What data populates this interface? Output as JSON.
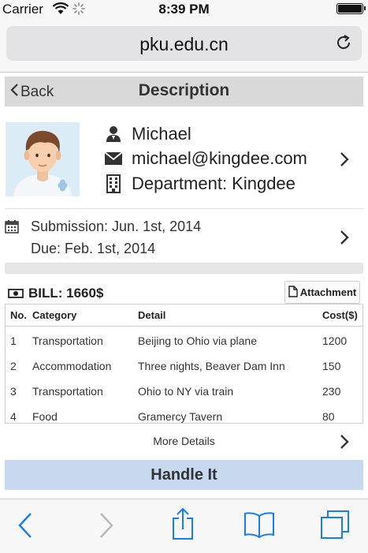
{
  "status": {
    "carrier": "Carrier",
    "time": "8:39 PM"
  },
  "browser": {
    "url": "pku.edu.cn"
  },
  "nav": {
    "back_label": "Back",
    "title": "Description"
  },
  "person": {
    "name": "Michael",
    "email": "michael@kingdee.com",
    "department": "Department: Kingdee"
  },
  "dates": {
    "submission": "Submission: Jun. 1st, 2014",
    "due": "Due: Feb. 1st, 2014"
  },
  "bill": {
    "title": "BILL: 1660$",
    "attachment_label": "Attachment",
    "columns": [
      "No.",
      "Category",
      "Detail",
      "Cost($)"
    ],
    "rows": [
      [
        "1",
        "Transportation",
        "Beijing to Ohio via plane",
        "1200"
      ],
      [
        "2",
        "Accommodation",
        "Three nights, Beaver Dam Inn",
        "150"
      ],
      [
        "3",
        "Transportation",
        "Ohio to NY via train",
        "230"
      ],
      [
        "4",
        "Food",
        "Gramercy Tavern",
        "80"
      ]
    ],
    "more_label": "More Details"
  },
  "action": {
    "handle_label": "Handle It"
  },
  "colors": {
    "accent": "#1a7cf5",
    "nav_bg": "#d9d9d9",
    "action_bg": "#c6d9ee"
  },
  "icons": [
    "wifi-icon",
    "spinner-icon",
    "battery-icon",
    "reload-icon",
    "back-chevron-icon",
    "user-icon",
    "mail-icon",
    "building-icon",
    "chevron-right-icon",
    "calendar-icon",
    "money-icon",
    "document-icon",
    "back-arrow-icon",
    "forward-arrow-icon",
    "share-icon",
    "bookmarks-icon",
    "tabs-icon"
  ]
}
